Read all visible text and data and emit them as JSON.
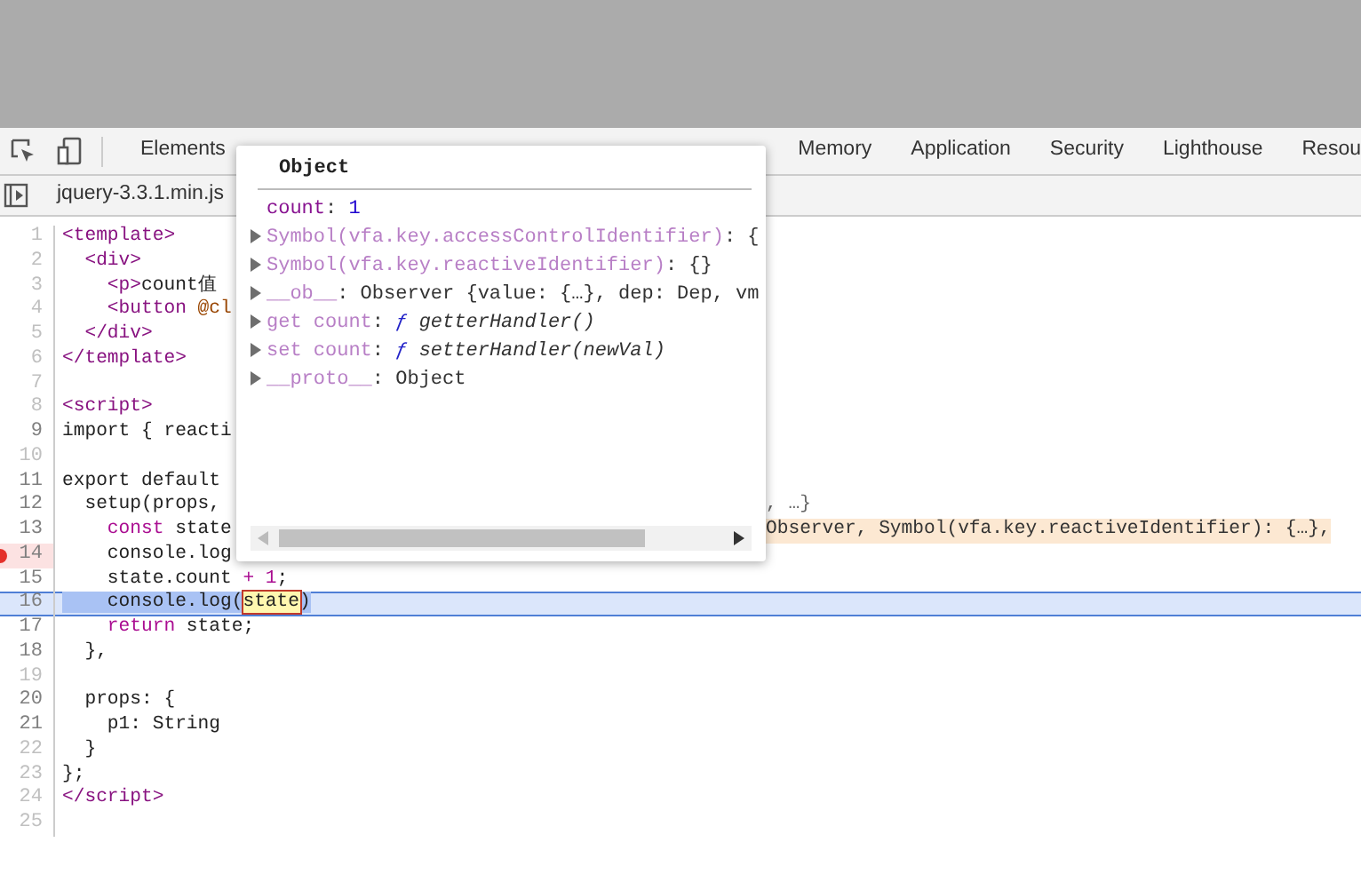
{
  "toolbar": {
    "tabs": [
      {
        "label": "Elements",
        "selected": false
      },
      {
        "label": "Memory",
        "selected": false
      },
      {
        "label": "Application",
        "selected": false
      },
      {
        "label": "Security",
        "selected": false
      },
      {
        "label": "Lighthouse",
        "selected": false
      },
      {
        "label": "Resou",
        "selected": false
      }
    ]
  },
  "file_tabs": [
    {
      "label": "jquery-3.3.1.min.js",
      "selected": false
    }
  ],
  "code_lines": [
    {
      "number": "1",
      "executable": false,
      "breakpoint": false,
      "current": false,
      "tokens": [
        {
          "kind": "tag",
          "text": "<template>"
        }
      ]
    },
    {
      "number": "2",
      "executable": false,
      "breakpoint": false,
      "current": false,
      "tokens": [
        {
          "kind": "tag",
          "text": "  <div>"
        }
      ]
    },
    {
      "number": "3",
      "executable": false,
      "breakpoint": false,
      "current": false,
      "tokens": [
        {
          "kind": "tag",
          "text": "    <p>"
        },
        {
          "kind": "plain",
          "text": "count值"
        }
      ]
    },
    {
      "number": "4",
      "executable": false,
      "breakpoint": false,
      "current": false,
      "tokens": [
        {
          "kind": "tag",
          "text": "    <button "
        },
        {
          "kind": "attr",
          "text": "@cl"
        }
      ]
    },
    {
      "number": "5",
      "executable": false,
      "breakpoint": false,
      "current": false,
      "tokens": [
        {
          "kind": "tag",
          "text": "  </div>"
        }
      ]
    },
    {
      "number": "6",
      "executable": false,
      "breakpoint": false,
      "current": false,
      "tokens": [
        {
          "kind": "tag",
          "text": "</template>"
        }
      ]
    },
    {
      "number": "7",
      "executable": false,
      "breakpoint": false,
      "current": false
    },
    {
      "number": "8",
      "executable": false,
      "breakpoint": false,
      "current": false,
      "tokens": [
        {
          "kind": "tag",
          "text": "<script>"
        }
      ]
    },
    {
      "number": "9",
      "executable": true,
      "breakpoint": false,
      "current": false,
      "tokens": [
        {
          "kind": "plain",
          "text": "import { reacti"
        }
      ]
    },
    {
      "number": "10",
      "executable": false,
      "breakpoint": false,
      "current": false
    },
    {
      "number": "11",
      "executable": true,
      "breakpoint": false,
      "current": false,
      "tokens": [
        {
          "kind": "plain",
          "text": "export default"
        }
      ]
    },
    {
      "number": "12",
      "executable": true,
      "breakpoint": false,
      "current": false,
      "tokens": [
        {
          "kind": "plain",
          "text": "  setup(props,"
        }
      ],
      "inline_value": {
        "text": ", …}",
        "kind": "plain"
      }
    },
    {
      "number": "13",
      "executable": true,
      "breakpoint": false,
      "current": false,
      "tokens": [
        {
          "kind": "keyword",
          "text": "    const"
        },
        {
          "kind": "plain",
          "text": " state"
        }
      ],
      "inline_value": {
        "text": "Observer, Symbol(vfa.key.reactiveIdentifier): {…},",
        "kind": "highlight"
      }
    },
    {
      "number": "14",
      "executable": true,
      "breakpoint": true,
      "current": false,
      "tokens": [
        {
          "kind": "plain",
          "text": "    console.log"
        }
      ]
    },
    {
      "number": "15",
      "executable": true,
      "breakpoint": false,
      "current": false,
      "tokens": [
        {
          "kind": "plain",
          "text": "    state.count "
        },
        {
          "kind": "keyword",
          "text": "+ 1"
        },
        {
          "kind": "plain",
          "text": ";"
        }
      ]
    },
    {
      "number": "16",
      "executable": true,
      "breakpoint": false,
      "current": true,
      "tokens": [
        {
          "kind": "plain",
          "text": "    console.log("
        },
        {
          "kind": "hovered",
          "text": "state"
        },
        {
          "kind": "plain",
          "text": ")"
        }
      ]
    },
    {
      "number": "17",
      "executable": true,
      "breakpoint": false,
      "current": false,
      "tokens": [
        {
          "kind": "keyword",
          "text": "    return"
        },
        {
          "kind": "plain",
          "text": " state;"
        }
      ]
    },
    {
      "number": "18",
      "executable": true,
      "breakpoint": false,
      "current": false,
      "tokens": [
        {
          "kind": "plain",
          "text": "  },"
        }
      ]
    },
    {
      "number": "19",
      "executable": false,
      "breakpoint": false,
      "current": false
    },
    {
      "number": "20",
      "executable": true,
      "breakpoint": false,
      "current": false,
      "tokens": [
        {
          "kind": "plain",
          "text": "  props: {"
        }
      ]
    },
    {
      "number": "21",
      "executable": true,
      "breakpoint": false,
      "current": false,
      "tokens": [
        {
          "kind": "plain",
          "text": "    p1: String"
        }
      ]
    },
    {
      "number": "22",
      "executable": false,
      "breakpoint": false,
      "current": false,
      "tokens": [
        {
          "kind": "plain",
          "text": "  }"
        }
      ]
    },
    {
      "number": "23",
      "executable": false,
      "breakpoint": false,
      "current": false,
      "tokens": [
        {
          "kind": "plain",
          "text": "};"
        }
      ]
    },
    {
      "number": "24",
      "executable": false,
      "breakpoint": false,
      "current": false,
      "tokens": [
        {
          "kind": "tag",
          "text": "</script>"
        }
      ]
    },
    {
      "number": "25",
      "executable": false,
      "breakpoint": false,
      "current": false
    }
  ],
  "popover": {
    "title": "Object",
    "properties": [
      {
        "expandable": false,
        "parts": [
          {
            "kind": "key",
            "text": "count"
          },
          {
            "kind": "plain",
            "text": ": "
          },
          {
            "kind": "number",
            "text": "1"
          }
        ]
      },
      {
        "expandable": true,
        "parts": [
          {
            "kind": "dimkey",
            "text": "Symbol(vfa.key.accessControlIdentifier)"
          },
          {
            "kind": "plain",
            "text": ": {"
          }
        ]
      },
      {
        "expandable": true,
        "parts": [
          {
            "kind": "dimkey",
            "text": "Symbol(vfa.key.reactiveIdentifier)"
          },
          {
            "kind": "plain",
            "text": ": {}"
          }
        ]
      },
      {
        "expandable": true,
        "parts": [
          {
            "kind": "dimkey",
            "text": "__ob__"
          },
          {
            "kind": "plain",
            "text": ": Observer {value: {…}, dep: Dep, vm"
          }
        ]
      },
      {
        "expandable": true,
        "parts": [
          {
            "kind": "dimkey",
            "text": "get count"
          },
          {
            "kind": "plain",
            "text": ": "
          },
          {
            "kind": "func",
            "text": "ƒ"
          },
          {
            "kind": "italic",
            "text": " getterHandler()"
          }
        ]
      },
      {
        "expandable": true,
        "parts": [
          {
            "kind": "dimkey",
            "text": "set count"
          },
          {
            "kind": "plain",
            "text": ": "
          },
          {
            "kind": "func",
            "text": "ƒ"
          },
          {
            "kind": "italic",
            "text": " setterHandler(newVal)"
          }
        ]
      },
      {
        "expandable": true,
        "parts": [
          {
            "kind": "dimkey",
            "text": "__proto__"
          },
          {
            "kind": "plain",
            "text": ": Object"
          }
        ]
      }
    ]
  }
}
